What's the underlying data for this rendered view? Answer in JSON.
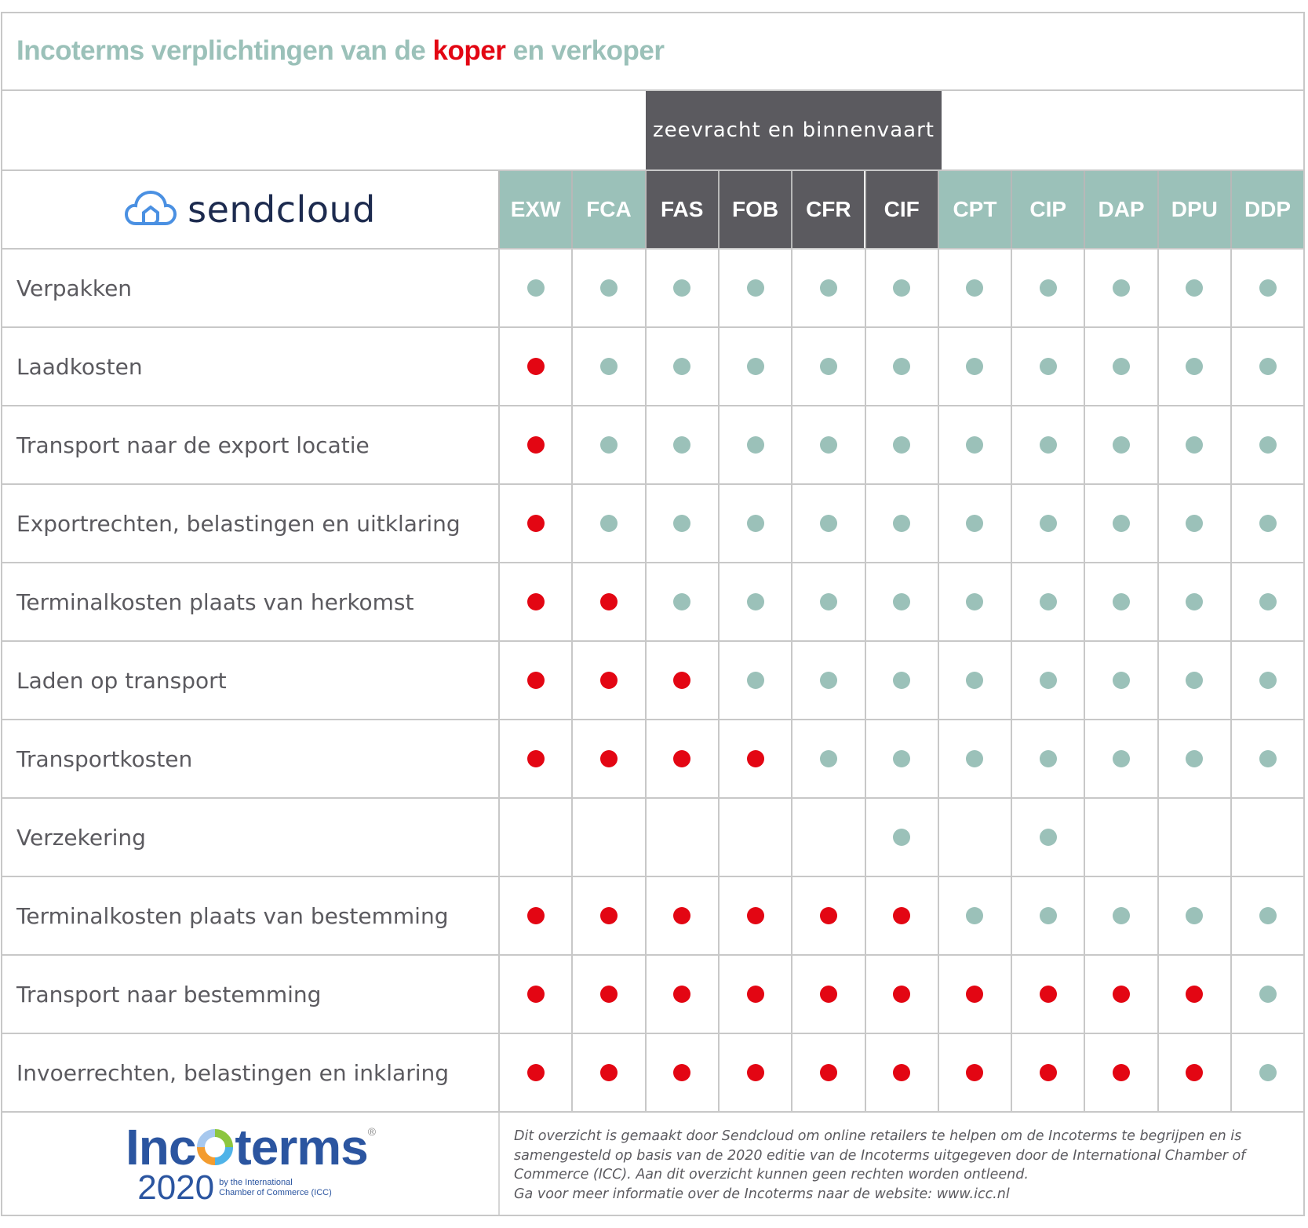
{
  "title": {
    "prefix": "Incoterms verplichtingen van de ",
    "highlight": "koper",
    "suffix": " en verkoper"
  },
  "colors": {
    "teal": "#9bc1b9",
    "dark": "#5b5a5f",
    "red": "#e30613",
    "logo_blue": "#4a90e2",
    "logo_navy": "#1d2b4f",
    "incoterms_blue": "#2b55a0"
  },
  "band": {
    "label": "zeevracht en binnenvaart"
  },
  "brand": {
    "name": "sendcloud"
  },
  "legend_meaning": {
    "red": "koper",
    "teal": "verkoper"
  },
  "columns": [
    {
      "code": "EXW",
      "group": "teal"
    },
    {
      "code": "FCA",
      "group": "teal"
    },
    {
      "code": "FAS",
      "group": "dark"
    },
    {
      "code": "FOB",
      "group": "dark"
    },
    {
      "code": "CFR",
      "group": "dark"
    },
    {
      "code": "CIF",
      "group": "dark"
    },
    {
      "code": "CPT",
      "group": "teal"
    },
    {
      "code": "CIP",
      "group": "teal"
    },
    {
      "code": "DAP",
      "group": "teal"
    },
    {
      "code": "DPU",
      "group": "teal"
    },
    {
      "code": "DDP",
      "group": "teal"
    }
  ],
  "rows": [
    {
      "label": "Verpakken",
      "cells": [
        "S",
        "S",
        "S",
        "S",
        "S",
        "S",
        "S",
        "S",
        "S",
        "S",
        "S"
      ]
    },
    {
      "label": "Laadkosten",
      "cells": [
        "B",
        "S",
        "S",
        "S",
        "S",
        "S",
        "S",
        "S",
        "S",
        "S",
        "S"
      ]
    },
    {
      "label": "Transport naar de export locatie",
      "cells": [
        "B",
        "S",
        "S",
        "S",
        "S",
        "S",
        "S",
        "S",
        "S",
        "S",
        "S"
      ]
    },
    {
      "label": "Exportrechten, belastingen en uitklaring",
      "cells": [
        "B",
        "S",
        "S",
        "S",
        "S",
        "S",
        "S",
        "S",
        "S",
        "S",
        "S"
      ]
    },
    {
      "label": "Terminalkosten plaats van herkomst",
      "cells": [
        "B",
        "B",
        "S",
        "S",
        "S",
        "S",
        "S",
        "S",
        "S",
        "S",
        "S"
      ]
    },
    {
      "label": "Laden op transport",
      "cells": [
        "B",
        "B",
        "B",
        "S",
        "S",
        "S",
        "S",
        "S",
        "S",
        "S",
        "S"
      ]
    },
    {
      "label": "Transportkosten",
      "cells": [
        "B",
        "B",
        "B",
        "B",
        "S",
        "S",
        "S",
        "S",
        "S",
        "S",
        "S"
      ]
    },
    {
      "label": "Verzekering",
      "cells": [
        "",
        "",
        "",
        "",
        "",
        "S",
        "",
        "S",
        "",
        "",
        ""
      ]
    },
    {
      "label": "Terminalkosten plaats van bestemming",
      "cells": [
        "B",
        "B",
        "B",
        "B",
        "B",
        "B",
        "S",
        "S",
        "S",
        "S",
        "S"
      ]
    },
    {
      "label": "Transport naar bestemming",
      "cells": [
        "B",
        "B",
        "B",
        "B",
        "B",
        "B",
        "B",
        "B",
        "B",
        "B",
        "S"
      ]
    },
    {
      "label": "Invoerrechten, belastingen en inklaring",
      "cells": [
        "B",
        "B",
        "B",
        "B",
        "B",
        "B",
        "B",
        "B",
        "B",
        "B",
        "S"
      ]
    }
  ],
  "footer": {
    "logo": {
      "word_left": "Inc",
      "word_right": "terms",
      "registered": "®",
      "year": "2020",
      "by_line1": "by the International",
      "by_line2": "Chamber of Commerce (ICC)"
    },
    "note_lines": [
      "Dit overzicht is gemaakt door Sendcloud om online retailers te helpen om de Incoterms te begrijpen en is",
      "samengesteld op basis van de 2020 editie van de Incoterms uitgegeven door de International Chamber of",
      "Commerce (ICC). Aan dit overzicht kunnen geen rechten worden ontleend.",
      "Ga voor meer informatie over de Incoterms naar de website: www.icc.nl"
    ]
  }
}
